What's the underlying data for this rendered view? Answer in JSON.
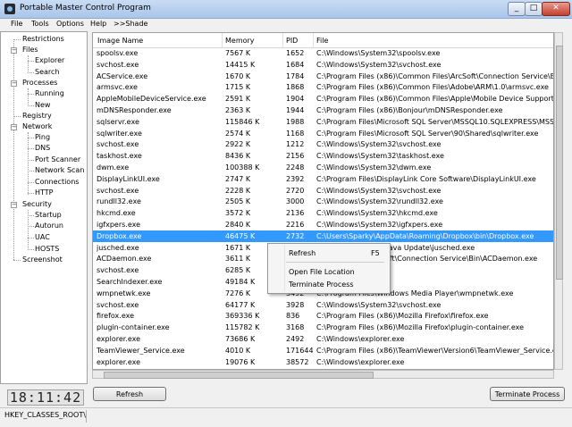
{
  "window": {
    "title": "Portable Master Control Program",
    "min": "_",
    "max": "□",
    "close": "✕"
  },
  "menu": [
    "File",
    "Tools",
    "Options",
    "Help",
    ">>Shade"
  ],
  "tree": {
    "restrictions": "Restrictions",
    "files": "Files",
    "explorer": "Explorer",
    "search": "Search",
    "processes": "Processes",
    "running": "Running",
    "new": "New",
    "registry": "Registry",
    "network": "Network",
    "ping": "Ping",
    "dns": "DNS",
    "port_scanner": "Port Scanner",
    "network_scan": "Network Scan",
    "connections": "Connections",
    "http": "HTTP",
    "security": "Security",
    "startup": "Startup",
    "autorun": "Autorun",
    "uac": "UAC",
    "hosts": "HOSTS",
    "screenshot": "Screenshot"
  },
  "clock": "18:11:42",
  "table": {
    "headers": {
      "name": "Image Name",
      "memory": "Memory",
      "pid": "PID",
      "file": "File"
    },
    "rows": [
      [
        "spoolsv.exe",
        "7567 K",
        "1652",
        "C:\\Windows\\System32\\spoolsv.exe"
      ],
      [
        "svchost.exe",
        "14415 K",
        "1684",
        "C:\\Windows\\System32\\svchost.exe"
      ],
      [
        "ACService.exe",
        "1670 K",
        "1784",
        "C:\\Program Files (x86)\\Common Files\\ArcSoft\\Connection Service\\Bin\\ACService.exe"
      ],
      [
        "armsvc.exe",
        "1715 K",
        "1868",
        "C:\\Program Files (x86)\\Common Files\\Adobe\\ARM\\1.0\\armsvc.exe"
      ],
      [
        "AppleMobileDeviceService.exe",
        "2591 K",
        "1904",
        "C:\\Program Files (x86)\\Common Files\\Apple\\Mobile Device Support\\AppleMobileDeviceService.exe"
      ],
      [
        "mDNSResponder.exe",
        "2363 K",
        "1944",
        "C:\\Program Files (x86)\\Bonjour\\mDNSResponder.exe"
      ],
      [
        "sqlservr.exe",
        "115846 K",
        "1988",
        "C:\\Program Files\\Microsoft SQL Server\\MSSQL10.SQLEXPRESS\\MSSQL\\Binn\\sqlservr.exe"
      ],
      [
        "sqlwriter.exe",
        "2574 K",
        "1168",
        "C:\\Program Files\\Microsoft SQL Server\\90\\Shared\\sqlwriter.exe"
      ],
      [
        "svchost.exe",
        "2922 K",
        "1212",
        "C:\\Windows\\System32\\svchost.exe"
      ],
      [
        "taskhost.exe",
        "8436 K",
        "2156",
        "C:\\Windows\\System32\\taskhost.exe"
      ],
      [
        "dwm.exe",
        "100388 K",
        "2248",
        "C:\\Windows\\System32\\dwm.exe"
      ],
      [
        "DisplayLinkUI.exe",
        "2747 K",
        "2392",
        "C:\\Program Files\\DisplayLink Core Software\\DisplayLinkUI.exe"
      ],
      [
        "svchost.exe",
        "2228 K",
        "2720",
        "C:\\Windows\\System32\\svchost.exe"
      ],
      [
        "rundll32.exe",
        "2505 K",
        "3000",
        "C:\\Windows\\System32\\rundll32.exe"
      ],
      [
        "hkcmd.exe",
        "3572 K",
        "2136",
        "C:\\Windows\\System32\\hkcmd.exe"
      ],
      [
        "igfxpers.exe",
        "2840 K",
        "2216",
        "C:\\Windows\\System32\\igfxpers.exe"
      ],
      [
        "Dropbox.exe",
        "46475 K",
        "2732",
        "C:\\Users\\Sparky\\AppData\\Roaming\\Dropbox\\bin\\Dropbox.exe"
      ],
      [
        "jusched.exe",
        "1671 K",
        "",
        "Common Files\\Java\\Java Update\\jusched.exe"
      ],
      [
        "ACDaemon.exe",
        "3611 K",
        "",
        "Common Files\\ArcSoft\\Connection Service\\Bin\\ACDaemon.exe"
      ],
      [
        "svchost.exe",
        "6285 K",
        "",
        "svchost.exe"
      ],
      [
        "SearchIndexer.exe",
        "49184 K",
        "",
        "SearchIndexer.exe"
      ],
      [
        "wmpnetwk.exe",
        "7276 K",
        "3492",
        "C:\\Program Files\\Windows Media Player\\wmpnetwk.exe"
      ],
      [
        "svchost.exe",
        "64177 K",
        "3928",
        "C:\\Windows\\System32\\svchost.exe"
      ],
      [
        "firefox.exe",
        "369336 K",
        "836",
        "C:\\Program Files (x86)\\Mozilla Firefox\\firefox.exe"
      ],
      [
        "plugin-container.exe",
        "115782 K",
        "3168",
        "C:\\Program Files (x86)\\Mozilla Firefox\\plugin-container.exe"
      ],
      [
        "explorer.exe",
        "73686 K",
        "2492",
        "C:\\Windows\\explorer.exe"
      ],
      [
        "TeamViewer_Service.exe",
        "4010 K",
        "171644",
        "C:\\Program Files (x86)\\TeamViewer\\Version6\\TeamViewer_Service.exe"
      ],
      [
        "explorer.exe",
        "19076 K",
        "38572",
        "C:\\Windows\\explorer.exe"
      ]
    ]
  },
  "context_menu": {
    "refresh": "Refresh",
    "refresh_shortcut": "F5",
    "open_location": "Open File Location",
    "terminate": "Terminate Process"
  },
  "buttons": {
    "refresh": "Refresh",
    "terminate": "Terminate Process"
  },
  "status": {
    "path": "HKEY_CLASSES_ROOT\\"
  },
  "colors": {
    "selected": "#3399ff",
    "titlebar": "#b9d1ea"
  }
}
